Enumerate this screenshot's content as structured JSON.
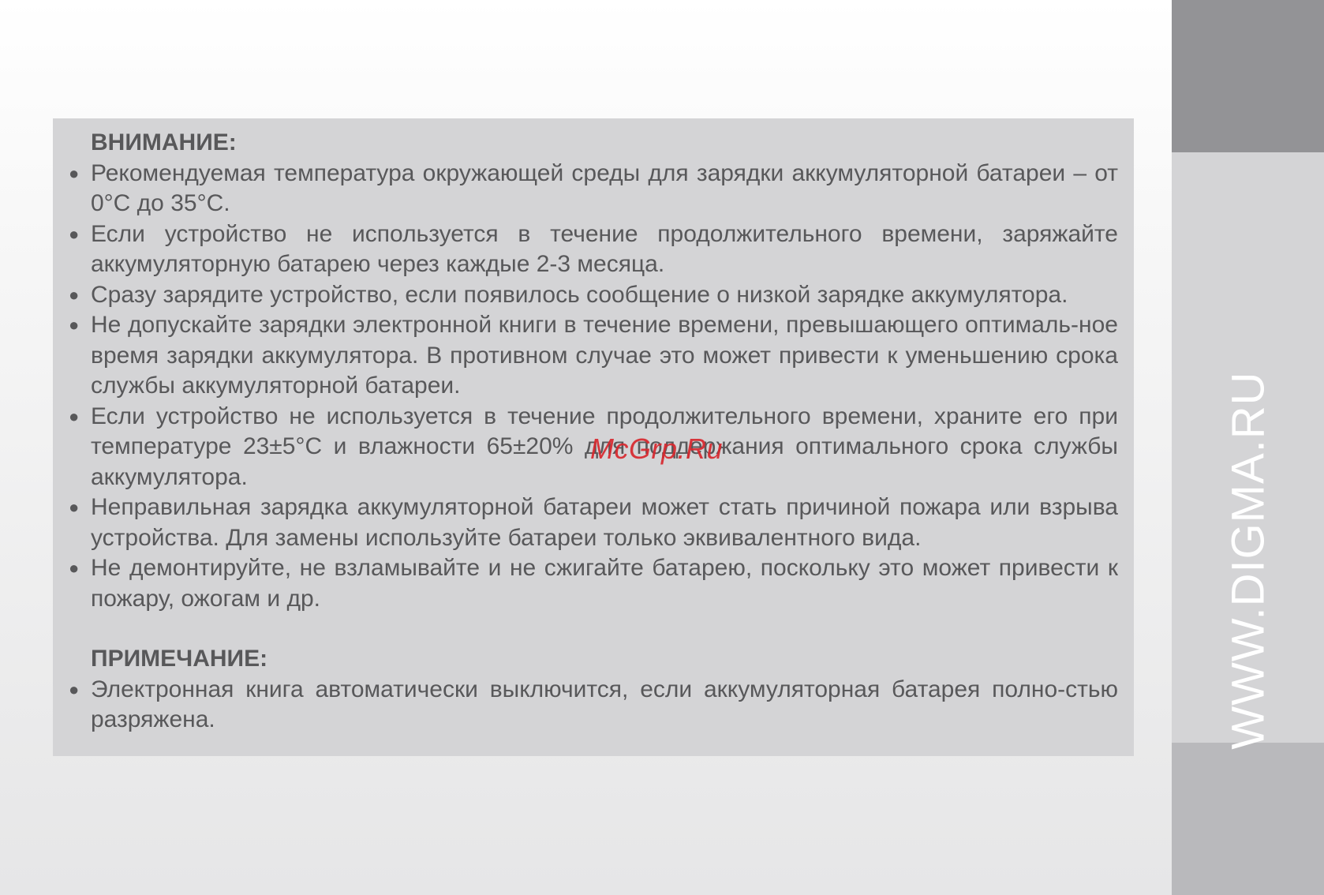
{
  "warning": {
    "title": "ВНИМАНИЕ:",
    "items": [
      "Рекомендуемая температура окружающей среды для зарядки аккумуляторной батареи – от 0°С до 35°С.",
      "Если устройство не используется в течение продолжительного времени, заряжайте аккумуляторную батарею через каждые 2-3 месяца.",
      "Сразу зарядите устройство, если появилось сообщение о низкой зарядке аккумулятора.",
      "Не допускайте зарядки электронной книги в течение времени, превышающего оптималь-ное время зарядки аккумулятора. В противном случае это может привести к уменьшению срока службы аккумуляторной батареи.",
      "Если устройство не используется в течение продолжительного времени, храните его при температуре 23±5°С и влажности 65±20% для поддержания оптимального срока службы аккумулятора.",
      "Неправильная зарядка аккумуляторной батареи может стать причиной пожара или взрыва устройства. Для замены используйте батареи только эквивалентного вида.",
      "Не демонтируйте, не взламывайте и не сжигайте батарею, поскольку это может привести к пожару, ожогам и др."
    ]
  },
  "note": {
    "title": "ПРИМЕЧАНИЕ:",
    "items": [
      "Электронная книга автоматически выключится, если аккумуляторная батарея полно-стью разряжена."
    ]
  },
  "bullet_symbol": "●",
  "watermark": "McGrp.Ru",
  "site_url": "WWW.DIGMA.RU",
  "colors": {
    "text": "#58585a",
    "box_background": "#d4d4d6",
    "sidebar_dark": "#939396",
    "sidebar_light": "#d4d4d6",
    "sidebar_bottom": "#b9b9bc",
    "watermark": "#d8282e",
    "site_url": "#ffffff"
  }
}
